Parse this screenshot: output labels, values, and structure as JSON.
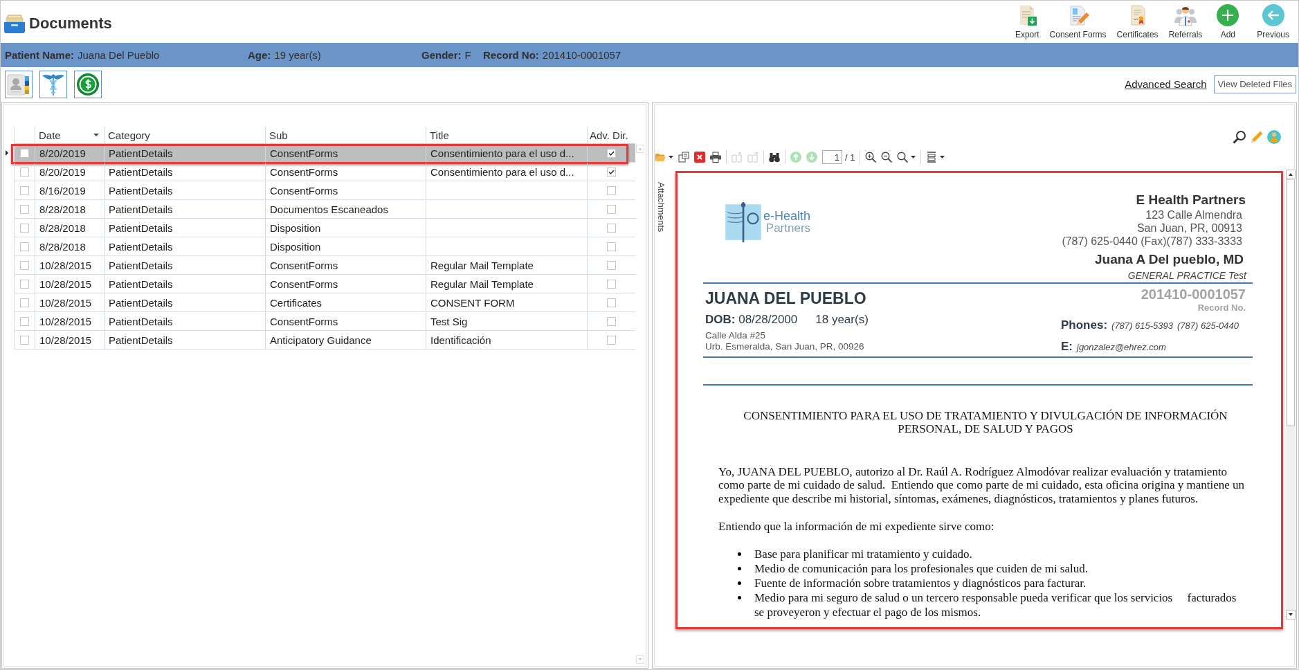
{
  "header": {
    "title": "Documents",
    "actions": [
      {
        "label": "Export"
      },
      {
        "label": "Consent Forms"
      },
      {
        "label": "Certificates"
      },
      {
        "label": "Referrals"
      },
      {
        "label": "Add"
      },
      {
        "label": "Previous"
      }
    ]
  },
  "patient": [
    {
      "label": "Patient Name:",
      "value": "Juana Del Pueblo"
    },
    {
      "label": "Age:",
      "value": "19 year(s)"
    },
    {
      "label": "Gender:",
      "value": "F"
    },
    {
      "label": "Record No:",
      "value": "201410-0001057"
    }
  ],
  "toolbar": {
    "link": "Advanced Search",
    "button": "View Deleted Files"
  },
  "table": {
    "columns": [
      {
        "label": "Date",
        "sorted": true
      },
      {
        "label": "Category",
        "sorted": false
      },
      {
        "label": "Sub",
        "sorted": false
      },
      {
        "label": "Title",
        "sorted": false
      },
      {
        "label": "Adv. Dir.",
        "sorted": false
      }
    ],
    "rows": [
      {
        "selected": true,
        "checked": false,
        "date": "8/20/2019",
        "category": "PatientDetails",
        "sub": "ConsentForms",
        "title": "Consentimiento para el uso d...",
        "adv_dir": true
      },
      {
        "selected": false,
        "checked": false,
        "date": "8/20/2019",
        "category": "PatientDetails",
        "sub": "ConsentForms",
        "title": "Consentimiento para el uso d...",
        "adv_dir": true
      },
      {
        "selected": false,
        "checked": false,
        "date": "8/16/2019",
        "category": "PatientDetails",
        "sub": "ConsentForms",
        "adv_dir": false
      },
      {
        "selected": false,
        "checked": false,
        "date": "8/28/2018",
        "category": "PatientDetails",
        "sub": "Documentos Escaneados",
        "adv_dir": false
      },
      {
        "selected": false,
        "checked": false,
        "date": "8/28/2018",
        "category": "PatientDetails",
        "sub": "Disposition",
        "adv_dir": false
      },
      {
        "selected": false,
        "checked": false,
        "date": "8/28/2018",
        "category": "PatientDetails",
        "sub": "Disposition",
        "adv_dir": false
      },
      {
        "selected": false,
        "checked": false,
        "date": "10/28/2015",
        "category": "PatientDetails",
        "sub": "ConsentForms",
        "title": "Regular Mail Template",
        "adv_dir": false
      },
      {
        "selected": false,
        "checked": false,
        "date": "10/28/2015",
        "category": "PatientDetails",
        "sub": "ConsentForms",
        "title": "Regular Mail Template",
        "adv_dir": false
      },
      {
        "selected": false,
        "checked": false,
        "date": "10/28/2015",
        "category": "PatientDetails",
        "sub": "Certificates",
        "title": "CONSENT FORM",
        "adv_dir": false
      },
      {
        "selected": false,
        "checked": false,
        "date": "10/28/2015",
        "category": "PatientDetails",
        "sub": "ConsentForms",
        "title": "Test Sig",
        "adv_dir": false
      },
      {
        "selected": false,
        "checked": false,
        "date": "10/28/2015",
        "category": "PatientDetails",
        "sub": "Anticipatory Guidance",
        "title": "Identificación",
        "adv_dir": false
      }
    ]
  },
  "viewer": {
    "tools": [
      {
        "disabled": false
      },
      {
        "disabled": false
      },
      {
        "disabled": false
      },
      {
        "disabled": false
      },
      {
        "disabled": true
      },
      {
        "disabled": true
      },
      {
        "disabled": false
      },
      {
        "disabled": true
      },
      {
        "disabled": true
      },
      {
        "disabled": false
      },
      {
        "disabled": false
      },
      {
        "disabled": false
      },
      {
        "disabled": false
      }
    ],
    "page": "1",
    "page_total": "/ 1",
    "side_tab": "Attachments"
  },
  "document": {
    "logo": [
      "e-Health",
      "Partners"
    ],
    "org": "E Health Partners",
    "org_lines": [
      "123 Calle Almendra",
      "San Juan, PR, 00913",
      "(787) 625-0440 (Fax)(787) 333-3333"
    ],
    "doctor": "Juana A Del pueblo, MD",
    "specialty": "GENERAL PRACTICE Test",
    "patient_name": "JUANA DEL PUEBLO",
    "dob": "**DOB:** 08/28/2000",
    "age": "18 year(s)",
    "address": [
      "Calle Alda #25",
      "Urb. Esmeralda, San Juan, PR, 00926"
    ],
    "record_no": "201410-0001057",
    "record_label": "Record No.",
    "phones_label": "Phones:",
    "phones": [
      "(787) 615-5393",
      "(787) 625-0440"
    ],
    "email_label": "E:",
    "email": "jgonzalez@ehrez.com",
    "heading": "CONSENTIMIENTO PARA EL USO DE TRATAMIENTO Y DIVULGACIÓN DE INFORMACIÓN PERSONAL, DE SALUD Y PAGOS",
    "paragraphs": [
      "Yo, JUANA DEL PUEBLO, autorizo al Dr. Raúl A. Rodríguez Almodóvar realizar evaluación y tratamiento como parte de mi cuidado de salud.  Entiendo que como parte de mi cuidado, esta oficina origina y mantiene un expediente que describe mi historial, síntomas, exámenes, diagnósticos, tratamientos y planes futuros.",
      "Entiendo que la información de mi expediente sirve como:"
    ],
    "bullets": [
      "Base para planificar mi tratamiento y cuidado.",
      "Medio de comunicación para los profesionales que cuiden de mi salud.",
      "Fuente de información sobre tratamientos y diagnósticos para facturar.",
      "Medio para mi seguro de salud o un tercero responsable pueda verificar que los servicios     facturados se proveyeron y efectuar el pago de los mismos."
    ]
  }
}
